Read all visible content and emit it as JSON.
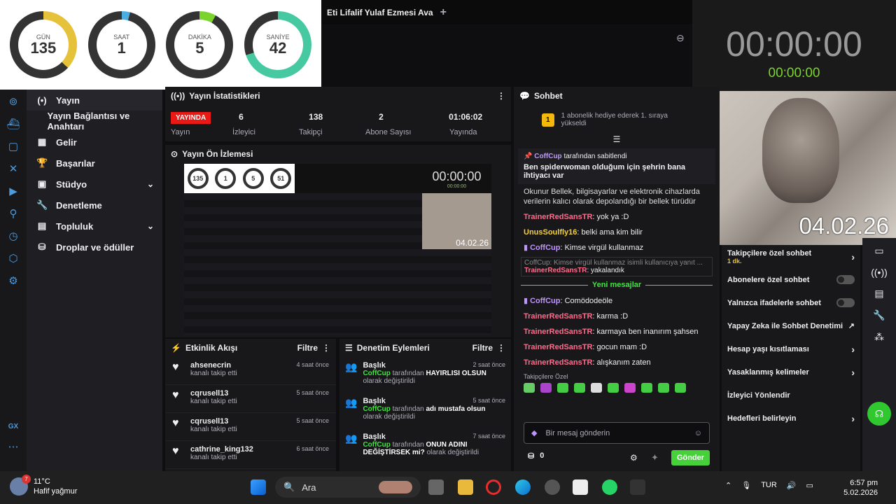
{
  "countdown": [
    {
      "label": "GÜN",
      "value": "135",
      "color": "#e6c13a",
      "pct": 0.37
    },
    {
      "label": "SAAT",
      "value": "1",
      "color": "#4aaee0",
      "pct": 0.04
    },
    {
      "label": "DAKİKA",
      "value": "5",
      "color": "#7bd42c",
      "pct": 0.08
    },
    {
      "label": "SANİYE",
      "value": "42",
      "color": "#46c9a1",
      "pct": 0.7
    }
  ],
  "tab": {
    "title": "Eti Lifalif Yulaf Ezmesi Ava",
    "new_tab": "+"
  },
  "timer": {
    "big": "00:00:00",
    "small": "00:00:00"
  },
  "camera": {
    "date": "04.02.26"
  },
  "nav": {
    "items": [
      {
        "label": "Yayın",
        "icon": "(•)"
      },
      {
        "label": "Yayın Bağlantısı ve Anahtarı",
        "icon": ""
      },
      {
        "label": "Gelir",
        "icon": "▦"
      },
      {
        "label": "Başarılar",
        "icon": "🏆"
      },
      {
        "label": "Stüdyo",
        "icon": "▣",
        "chev": "⌄"
      },
      {
        "label": "Denetleme",
        "icon": "🔧"
      },
      {
        "label": "Topluluk",
        "icon": "▤",
        "chev": "⌄"
      },
      {
        "label": "Droplar ve ödüller",
        "icon": "⛁"
      }
    ]
  },
  "stats": {
    "title": "Yayın İstatistikleri",
    "live": "YAYINDA",
    "values": [
      "6",
      "138",
      "2",
      "01:06:02"
    ],
    "labels": [
      "Yayın",
      "İzleyici",
      "Takipçi",
      "Abone Sayısı",
      "Yayında"
    ]
  },
  "preview": {
    "title": "Yayın Ön İzlemesi",
    "mini_rings": [
      "135",
      "1",
      "5",
      "51"
    ],
    "mini_timer": "00:00:00",
    "mini_timer2": "00:00:00",
    "mini_date": "04.02.26"
  },
  "feed": {
    "title": "Etkinlik Akışı",
    "filter": "Filtre",
    "items": [
      {
        "name": "ahsenecrin",
        "sub": "kanalı takip etti",
        "time": "4 saat önce"
      },
      {
        "name": "cqrusell13",
        "sub": "kanalı takip etti",
        "time": "5 saat önce"
      },
      {
        "name": "cqrusell13",
        "sub": "kanalı takip etti",
        "time": "5 saat önce"
      },
      {
        "name": "cathrine_king132",
        "sub": "kanalı takip etti",
        "time": "6 saat önce"
      }
    ]
  },
  "mod": {
    "title": "Denetim Eylemleri",
    "filter": "Filtre",
    "items": [
      {
        "title": "Başlık",
        "user": "CoffCup",
        "pre": "tarafından",
        "value": "HAYIRLISI OLSUN",
        "post": "olarak değiştirildi",
        "time": "2 saat önce"
      },
      {
        "title": "Başlık",
        "user": "CoffCup",
        "pre": "tarafından",
        "value": "adı mustafa olsun",
        "post": "olarak değiştirildi",
        "time": "5 saat önce"
      },
      {
        "title": "Başlık",
        "user": "CoffCup",
        "pre": "tarafından",
        "value": "ONUN ADINI DEĞİŞTİRSEK mi?",
        "post": "olarak değiştirildi",
        "time": "7 saat önce"
      }
    ]
  },
  "chat": {
    "title": "Sohbet",
    "banner": "1 abonelik hediye ederek 1. sıraya yükseldi",
    "pinned_by": "CoffCup",
    "pinned_suffix": "tarafından sabitlendi",
    "pinned_text": "Ben spiderwoman olduğum için şehrin bana ihtiyacı var",
    "info": "Okunur Bellek, bilgisayarlar ve elektronik cihazlarda verilerin kalıcı olarak depolandığı bir bellek türüdür",
    "messages_before": [
      {
        "user": "TrainerRedSansTR",
        "text": ": yok ya :D",
        "cls": "cname"
      },
      {
        "user": "UnusSoulfly16",
        "text": ": belki ama kim bilir",
        "cls": "cname3"
      },
      {
        "user": "CoffCup",
        "text": ": Kimse virgül kullanmaz",
        "cls": "cname2"
      }
    ],
    "reply_quote": "CoffCup: Kimse virgül kullanmaz isimli kullanıcıya yanıt ...",
    "reply_user": "TrainerRedSansTR",
    "reply_text": ": yakalandık",
    "new_messages": "Yeni mesajlar",
    "messages_after": [
      {
        "user": "CoffCup",
        "text": ": Comödodeöle",
        "cls": "cname2"
      },
      {
        "user": "TrainerRedSansTR",
        "text": ": karma :D",
        "cls": "cname"
      },
      {
        "user": "TrainerRedSansTR",
        "text": ": karmaya ben inanırım şahsen",
        "cls": "cname"
      },
      {
        "user": "TrainerRedSansTR",
        "text": ": gocun mam :D",
        "cls": "cname"
      },
      {
        "user": "TrainerRedSansTR",
        "text": ": alışkanım zaten",
        "cls": "cname"
      }
    ],
    "followers_only": "Takipçilere Özel",
    "placeholder": "Bir mesaj gönderin",
    "points": "0",
    "send": "Gönder"
  },
  "settings": {
    "items": [
      {
        "label": "Takipçilere özel sohbet",
        "sub": "1 dk.",
        "ctrl": "chevron"
      },
      {
        "label": "Abonelere özel sohbet",
        "ctrl": "toggle"
      },
      {
        "label": "Yalnızca ifadelerle sohbet",
        "ctrl": "toggle"
      },
      {
        "label": "Yapay Zeka ile Sohbet Denetimi",
        "ctrl": "ext"
      },
      {
        "label": "Hesap yaşı kısıtlaması",
        "ctrl": "chevron"
      },
      {
        "label": "Yasaklanmış kelimeler",
        "ctrl": "chevron"
      },
      {
        "label": "İzleyici Yönlendir",
        "ctrl": ""
      },
      {
        "label": "Hedefleri belirleyin",
        "ctrl": "chevron"
      }
    ]
  },
  "taskbar": {
    "temp": "11°C",
    "weather": "Hafif yağmur",
    "badge": "7",
    "search": "Ara",
    "lang": "TUR",
    "time": "6:57 pm",
    "date": "5.02.2026"
  }
}
